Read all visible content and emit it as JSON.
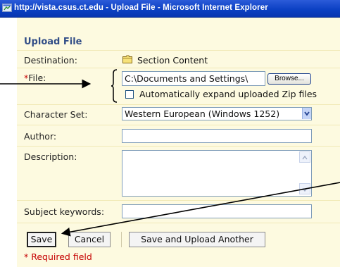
{
  "window": {
    "title": "http://vista.csus.ct.edu - Upload File - Microsoft Internet Explorer"
  },
  "form": {
    "title": "Upload File",
    "destination_label": "Destination:",
    "destination_value": "Section Content",
    "file_required_mark": "*",
    "file_label": "File:",
    "file_value": "C:\\Documents and Settings\\",
    "browse_label": "Browse...",
    "auto_expand_label": "Automatically expand uploaded Zip files",
    "auto_expand_checked": false,
    "charset_label": "Character Set:",
    "charset_value": "Western European (Windows 1252)",
    "author_label": "Author:",
    "author_value": "",
    "description_label": "Description:",
    "description_value": "",
    "keywords_label": "Subject keywords:",
    "keywords_value": ""
  },
  "buttons": {
    "save": "Save",
    "cancel": "Cancel",
    "save_another": "Save and Upload Another"
  },
  "required_note": "* Required field",
  "colors": {
    "titlebar": "#0a3fc2",
    "form_background": "#fdfae0",
    "title_text": "#314d87",
    "required": "#c50000"
  },
  "icons": {
    "window_icon": "ie-window-icon",
    "destination_icon": "folder-icon"
  }
}
